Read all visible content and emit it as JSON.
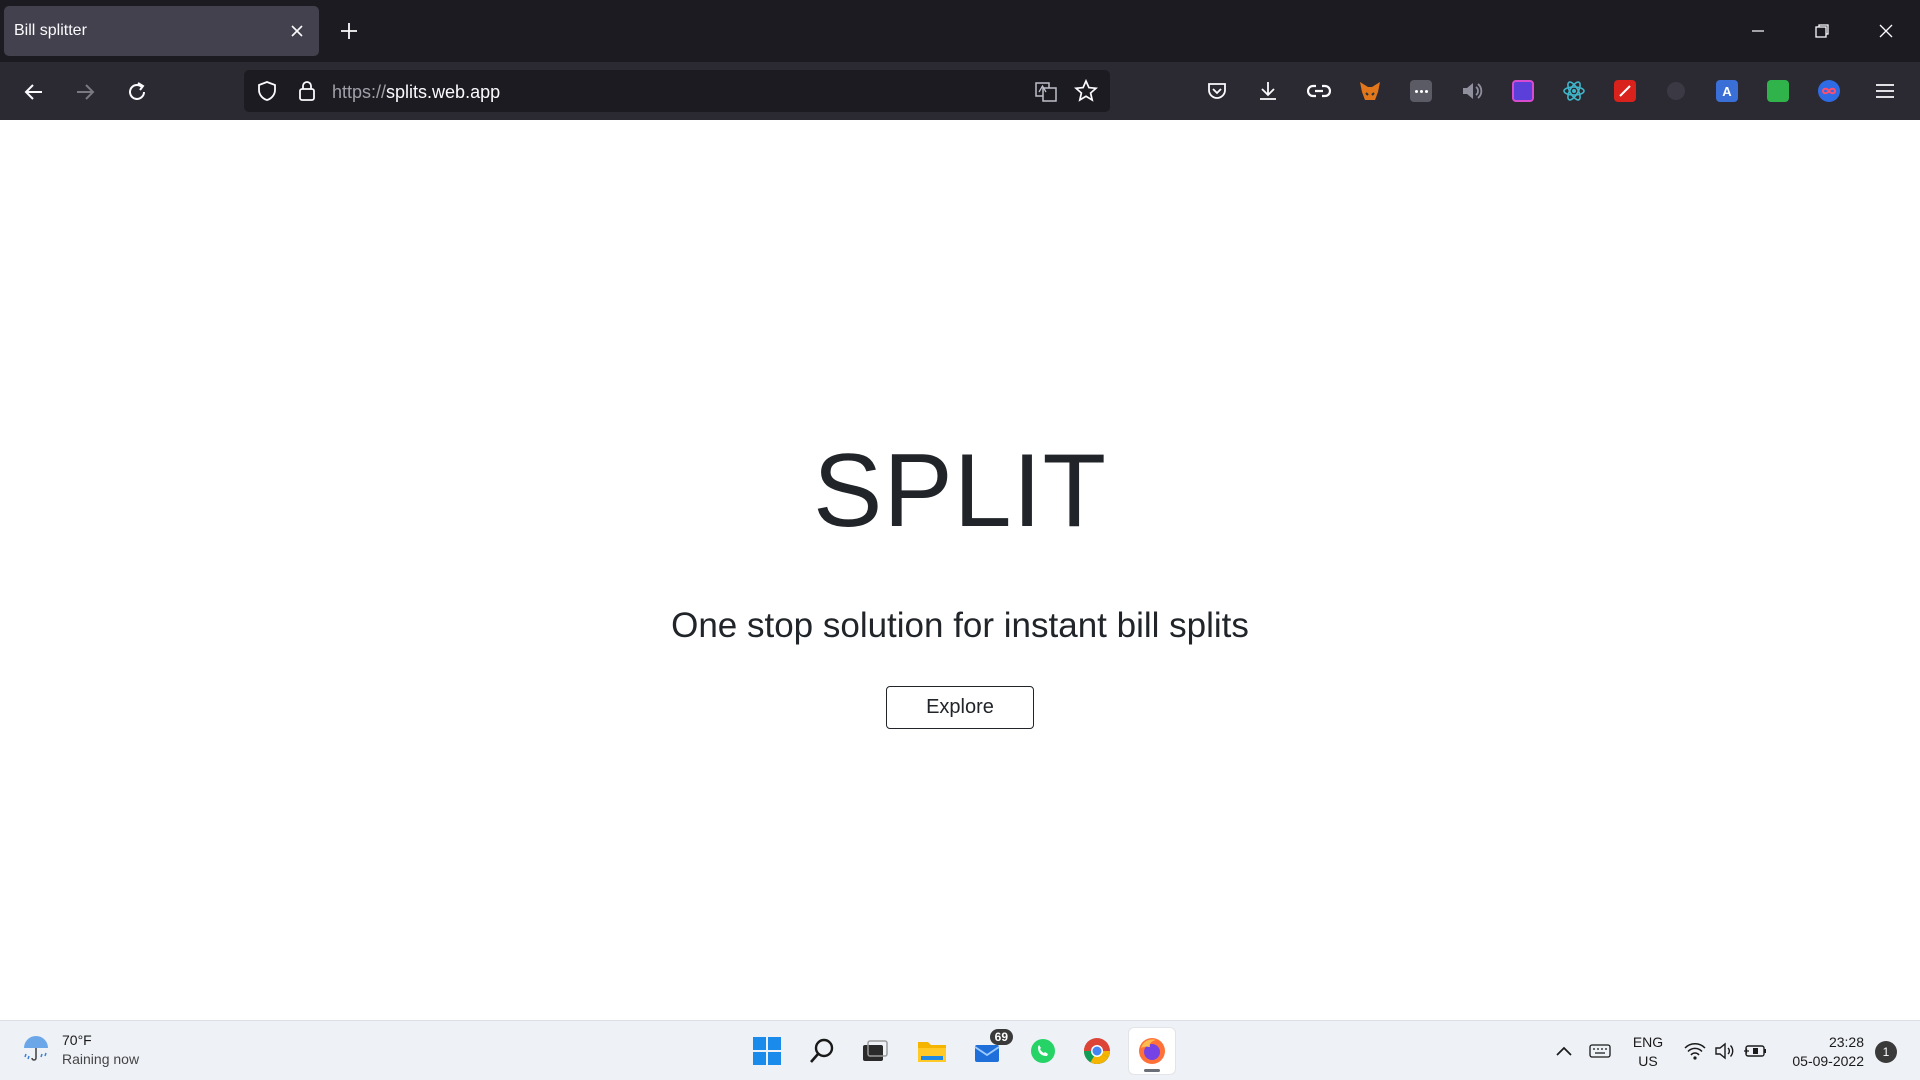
{
  "browser": {
    "tab": {
      "title": "Bill splitter"
    },
    "url": {
      "scheme": "https://",
      "host": "splits.web.app"
    }
  },
  "page": {
    "title": "SPLIT",
    "subtitle": "One stop solution for instant bill splits",
    "explore_label": "Explore"
  },
  "taskbar": {
    "weather": {
      "temp": "70°F",
      "desc": "Raining now"
    },
    "mail_badge": "69",
    "lang": {
      "line1": "ENG",
      "line2": "US"
    },
    "clock": {
      "time": "23:28",
      "date": "05-09-2022"
    },
    "notification_count": "1"
  },
  "colors": {
    "tab_strip": "#1c1b22",
    "toolbar": "#2b2a33",
    "text_dark": "#212529",
    "taskbar": "#eef1f6"
  }
}
